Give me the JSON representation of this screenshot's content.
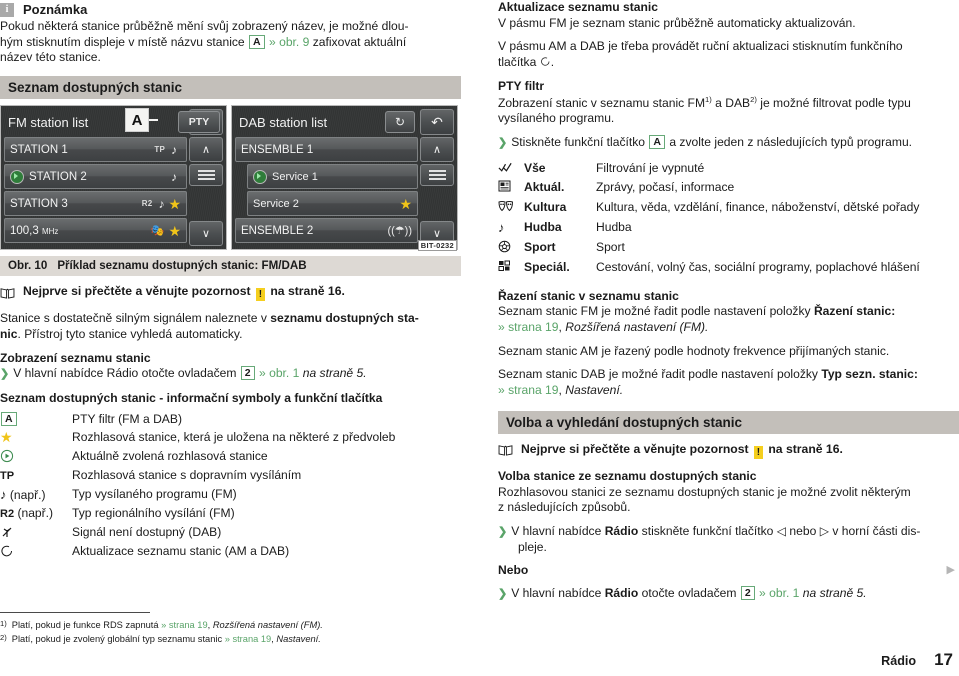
{
  "note": {
    "icon": "info-icon",
    "title": "Poznámka",
    "body_1": "Pokud některá stanice průběžně mění svůj zobrazený název, je možné dlou-",
    "body_2": "hým stisknutím displeje v místě názvu stanice",
    "key_a": "A",
    "ref": "» obr. 9",
    "body_3": "zafixovat aktuální",
    "body_4": "název této stanice."
  },
  "section_station_list": {
    "heading": "Seznam dostupných stanic",
    "caption_num": "Obr. 10",
    "caption_text": "Příklad seznamu dostupných stanic: FM/DAB",
    "read_first_pre": "Nejprve si přečtěte a věnujte pozornost",
    "read_first_warn": "!",
    "read_first_post": "na straně 16.",
    "para_1": "Stanice s dostatečně silným signálem naleznete v ",
    "para_1_bold": "seznamu dostupných sta-",
    "para_1_bold2": "nic",
    "para_1_rest": ". Přístroj tyto stanice vyhledá automaticky.",
    "sub_display": "Zobrazení seznamu stanic",
    "bullet_display_pre": "V hlavní nabídce Rádio otočte ovladačem",
    "bullet_display_key": "2",
    "bullet_display_ref": "» obr. 1",
    "bullet_display_italic": "na straně 5.",
    "symbols_heading": "Seznam dostupných stanic - informační symboly a funkční tlačítka",
    "symbols": [
      {
        "glyph": "key-a-box",
        "label": "A",
        "note": "",
        "desc": "PTY filtr (FM a DAB)"
      },
      {
        "glyph": "star-icon",
        "label": "★",
        "note": "",
        "desc": "Rozhlasová stanice, která je uložena na některé z předvoleb"
      },
      {
        "glyph": "play-circle-icon",
        "label": "⊙",
        "note": "",
        "desc": "Aktuálně zvolená rozhlasová stanice"
      },
      {
        "glyph": "tp-icon",
        "label": "TP",
        "note": "",
        "desc": "Rozhlasová stanice s dopravním vysíláním"
      },
      {
        "glyph": "music-note-icon",
        "label": "♪",
        "note": "(např.)",
        "desc": "Typ vysílaného programu (FM)"
      },
      {
        "glyph": "r2-icon",
        "label": "R2",
        "note": "(např.)",
        "desc": "Typ regionálního vysílání (FM)"
      },
      {
        "glyph": "no-signal-icon",
        "label": "✗",
        "note": "",
        "desc": "Signál není dostupný (DAB)"
      },
      {
        "glyph": "refresh-icon",
        "label": "◯",
        "note": "",
        "desc": "Aktualizace seznamu stanic (AM a DAB)"
      }
    ]
  },
  "figure": {
    "bit_code": "BIT-0232",
    "fm_panel": {
      "title": "FM station list",
      "callout": "A",
      "pty_button": "PTY",
      "back_button": "back-arrow-icon",
      "rows": [
        {
          "name": "STATION 1",
          "meta": "TP",
          "music": true,
          "star": false,
          "current": false
        },
        {
          "name": "STATION 2",
          "meta": "",
          "music": true,
          "star": false,
          "current": true
        },
        {
          "name": "STATION 3",
          "meta": "R2",
          "music": true,
          "star": true,
          "current": false
        },
        {
          "name": "100,3",
          "unit": "MHz",
          "meta": "",
          "mask": true,
          "star": true,
          "current": false
        }
      ],
      "side_buttons": [
        "up-arrow-icon",
        "list-icon",
        "down-arrow-icon"
      ]
    },
    "dab_panel": {
      "title": "DAB station list",
      "refresh_button": "refresh-icon",
      "back_button": "back-arrow-icon",
      "rows": [
        {
          "name": "ENSEMBLE 1",
          "indent": false,
          "star": false,
          "current": false,
          "nosignal": false
        },
        {
          "name": "Service 1",
          "indent": true,
          "star": false,
          "current": true,
          "nosignal": false
        },
        {
          "name": "Service 2",
          "indent": true,
          "star": true,
          "current": false,
          "nosignal": false
        },
        {
          "name": "ENSEMBLE 2",
          "indent": false,
          "star": false,
          "current": false,
          "nosignal": true
        }
      ],
      "side_buttons": [
        "up-arrow-icon",
        "list-icon",
        "down-arrow-icon"
      ]
    }
  },
  "footnotes": [
    {
      "marker": "1)",
      "text_a": "Platí, pokud je funkce RDS zapnutá ",
      "ref": "» strana 19",
      "text_b": ", ",
      "italic": "Rozšířená nastavení (FM)."
    },
    {
      "marker": "2)",
      "text_a": "Platí, pokud je zvolený globální typ seznamu stanic ",
      "ref": "» strana 19",
      "text_b": ", ",
      "italic": "Nastavení."
    }
  ],
  "right_column": {
    "update_heading": "Aktualizace seznamu stanic",
    "update_p1": "V pásmu FM je seznam stanic průběžně automaticky aktualizován.",
    "update_p2a": "V pásmu AM a DAB je třeba provádět ruční aktualizaci stisknutím funkčního",
    "update_p2b": "tlačítka",
    "update_p2c": ".",
    "pty_heading": "PTY filtr",
    "pty_p1a": "Zobrazení stanic v seznamu stanic FM",
    "pty_sup1": "1)",
    "pty_p1b": " a DAB",
    "pty_sup2": "2)",
    "pty_p1c": " je možné filtrovat podle typu",
    "pty_p1d": "vysílaného programu.",
    "pty_bullet_a": "Stiskněte funkční tlačítko",
    "pty_bullet_key": "A",
    "pty_bullet_b": "a zvolte jeden z následujících typů programu.",
    "pty_types": [
      {
        "icon": "all-icon",
        "name": "Vše",
        "desc": "Filtrování je vypnuté"
      },
      {
        "icon": "news-icon",
        "name": "Aktuál.",
        "desc": "Zprávy, počasí, informace"
      },
      {
        "icon": "masks-icon",
        "name": "Kultura",
        "desc": "Kultura, věda, vzdělání, finance, náboženství, dětské pořady"
      },
      {
        "icon": "note-icon",
        "name": "Hudba",
        "desc": "Hudba"
      },
      {
        "icon": "ball-icon",
        "name": "Sport",
        "desc": "Sport"
      },
      {
        "icon": "grid-icon",
        "name": "Speciál.",
        "desc": "Cestování, volný čas, sociální programy, poplachové hlášení"
      }
    ],
    "sort_heading": "Řazení stanic v seznamu stanic",
    "sort_p1a": "Seznam stanic FM je možné řadit podle nastavení položky ",
    "sort_p1_bold": "Řazení stanic",
    "sort_p1_colon": ":",
    "sort_p1_ref": "» strana 19",
    "sort_p1_tail": ", ",
    "sort_p1_italic": "Rozšířená nastavení (FM).",
    "sort_p2": "Seznam stanic AM je řazený podle hodnoty frekvence přijímaných stanic.",
    "sort_p3a": "Seznam stanic DAB je možné řadit podle nastavení položky ",
    "sort_p3_bold": "Typ sezn. stanic",
    "sort_p3_colon": ":",
    "sort_p3_ref": "» strana 19",
    "sort_p3_tail": ", ",
    "sort_p3_italic": "Nastavení.",
    "choose_heading": "Volba a vyhledání dostupných stanic",
    "choose_read_pre": "Nejprve si přečtěte a věnujte pozornost",
    "choose_read_warn": "!",
    "choose_read_post": "na straně 16.",
    "choose_sub": "Volba stanice ze seznamu dostupných stanic",
    "choose_p1a": "Rozhlasovou stanici ze seznamu dostupných stanic je možné zvolit některým",
    "choose_p1b": "z následujících způsobů.",
    "choose_b1_a": "V hlavní nabídce ",
    "choose_b1_bold": "Rádio",
    "choose_b1_b": " stiskněte funkční tlačítko ◁ nebo ▷ v horní části dis-",
    "choose_b1_c": "pleje.",
    "choose_or": "Nebo",
    "choose_b2_a": "V hlavní nabídce ",
    "choose_b2_bold": "Rádio",
    "choose_b2_b": " otočte ovladačem",
    "choose_b2_key": "2",
    "choose_b2_ref": "» obr. 1",
    "choose_b2_italic": "na straně 5."
  },
  "footer": {
    "chapter": "Rádio",
    "page_number": "17",
    "continue_arrow": "▶"
  },
  "colors": {
    "section_bar": "#c3bfba",
    "caption_bar": "#ddd9d4",
    "reference_green": "#5aa469",
    "warning_yellow": "#f5cf1e",
    "star_gold": "#f0c419",
    "key_border_green": "#67a978"
  }
}
